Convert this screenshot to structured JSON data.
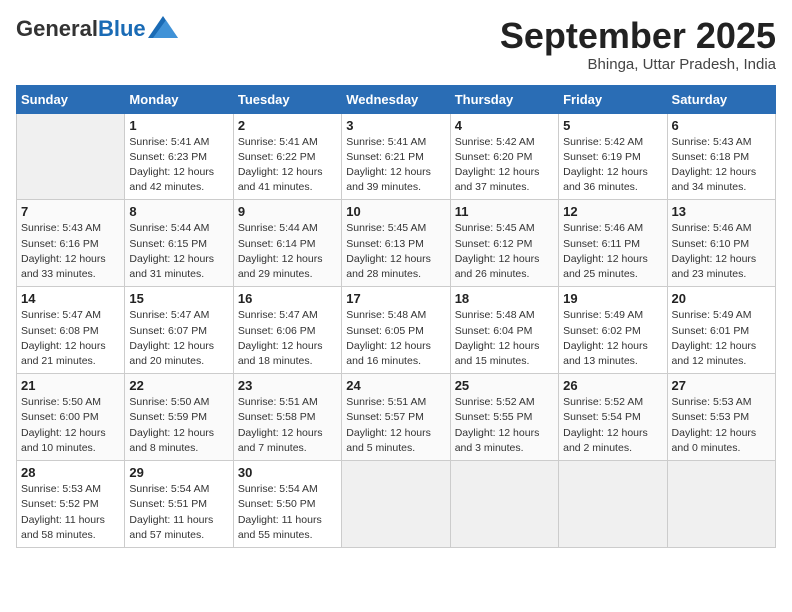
{
  "header": {
    "logo_general": "General",
    "logo_blue": "Blue",
    "month": "September 2025",
    "location": "Bhinga, Uttar Pradesh, India"
  },
  "weekdays": [
    "Sunday",
    "Monday",
    "Tuesday",
    "Wednesday",
    "Thursday",
    "Friday",
    "Saturday"
  ],
  "weeks": [
    [
      {
        "day": "",
        "detail": ""
      },
      {
        "day": "1",
        "detail": "Sunrise: 5:41 AM\nSunset: 6:23 PM\nDaylight: 12 hours\nand 42 minutes."
      },
      {
        "day": "2",
        "detail": "Sunrise: 5:41 AM\nSunset: 6:22 PM\nDaylight: 12 hours\nand 41 minutes."
      },
      {
        "day": "3",
        "detail": "Sunrise: 5:41 AM\nSunset: 6:21 PM\nDaylight: 12 hours\nand 39 minutes."
      },
      {
        "day": "4",
        "detail": "Sunrise: 5:42 AM\nSunset: 6:20 PM\nDaylight: 12 hours\nand 37 minutes."
      },
      {
        "day": "5",
        "detail": "Sunrise: 5:42 AM\nSunset: 6:19 PM\nDaylight: 12 hours\nand 36 minutes."
      },
      {
        "day": "6",
        "detail": "Sunrise: 5:43 AM\nSunset: 6:18 PM\nDaylight: 12 hours\nand 34 minutes."
      }
    ],
    [
      {
        "day": "7",
        "detail": "Sunrise: 5:43 AM\nSunset: 6:16 PM\nDaylight: 12 hours\nand 33 minutes."
      },
      {
        "day": "8",
        "detail": "Sunrise: 5:44 AM\nSunset: 6:15 PM\nDaylight: 12 hours\nand 31 minutes."
      },
      {
        "day": "9",
        "detail": "Sunrise: 5:44 AM\nSunset: 6:14 PM\nDaylight: 12 hours\nand 29 minutes."
      },
      {
        "day": "10",
        "detail": "Sunrise: 5:45 AM\nSunset: 6:13 PM\nDaylight: 12 hours\nand 28 minutes."
      },
      {
        "day": "11",
        "detail": "Sunrise: 5:45 AM\nSunset: 6:12 PM\nDaylight: 12 hours\nand 26 minutes."
      },
      {
        "day": "12",
        "detail": "Sunrise: 5:46 AM\nSunset: 6:11 PM\nDaylight: 12 hours\nand 25 minutes."
      },
      {
        "day": "13",
        "detail": "Sunrise: 5:46 AM\nSunset: 6:10 PM\nDaylight: 12 hours\nand 23 minutes."
      }
    ],
    [
      {
        "day": "14",
        "detail": "Sunrise: 5:47 AM\nSunset: 6:08 PM\nDaylight: 12 hours\nand 21 minutes."
      },
      {
        "day": "15",
        "detail": "Sunrise: 5:47 AM\nSunset: 6:07 PM\nDaylight: 12 hours\nand 20 minutes."
      },
      {
        "day": "16",
        "detail": "Sunrise: 5:47 AM\nSunset: 6:06 PM\nDaylight: 12 hours\nand 18 minutes."
      },
      {
        "day": "17",
        "detail": "Sunrise: 5:48 AM\nSunset: 6:05 PM\nDaylight: 12 hours\nand 16 minutes."
      },
      {
        "day": "18",
        "detail": "Sunrise: 5:48 AM\nSunset: 6:04 PM\nDaylight: 12 hours\nand 15 minutes."
      },
      {
        "day": "19",
        "detail": "Sunrise: 5:49 AM\nSunset: 6:02 PM\nDaylight: 12 hours\nand 13 minutes."
      },
      {
        "day": "20",
        "detail": "Sunrise: 5:49 AM\nSunset: 6:01 PM\nDaylight: 12 hours\nand 12 minutes."
      }
    ],
    [
      {
        "day": "21",
        "detail": "Sunrise: 5:50 AM\nSunset: 6:00 PM\nDaylight: 12 hours\nand 10 minutes."
      },
      {
        "day": "22",
        "detail": "Sunrise: 5:50 AM\nSunset: 5:59 PM\nDaylight: 12 hours\nand 8 minutes."
      },
      {
        "day": "23",
        "detail": "Sunrise: 5:51 AM\nSunset: 5:58 PM\nDaylight: 12 hours\nand 7 minutes."
      },
      {
        "day": "24",
        "detail": "Sunrise: 5:51 AM\nSunset: 5:57 PM\nDaylight: 12 hours\nand 5 minutes."
      },
      {
        "day": "25",
        "detail": "Sunrise: 5:52 AM\nSunset: 5:55 PM\nDaylight: 12 hours\nand 3 minutes."
      },
      {
        "day": "26",
        "detail": "Sunrise: 5:52 AM\nSunset: 5:54 PM\nDaylight: 12 hours\nand 2 minutes."
      },
      {
        "day": "27",
        "detail": "Sunrise: 5:53 AM\nSunset: 5:53 PM\nDaylight: 12 hours\nand 0 minutes."
      }
    ],
    [
      {
        "day": "28",
        "detail": "Sunrise: 5:53 AM\nSunset: 5:52 PM\nDaylight: 11 hours\nand 58 minutes."
      },
      {
        "day": "29",
        "detail": "Sunrise: 5:54 AM\nSunset: 5:51 PM\nDaylight: 11 hours\nand 57 minutes."
      },
      {
        "day": "30",
        "detail": "Sunrise: 5:54 AM\nSunset: 5:50 PM\nDaylight: 11 hours\nand 55 minutes."
      },
      {
        "day": "",
        "detail": ""
      },
      {
        "day": "",
        "detail": ""
      },
      {
        "day": "",
        "detail": ""
      },
      {
        "day": "",
        "detail": ""
      }
    ]
  ]
}
